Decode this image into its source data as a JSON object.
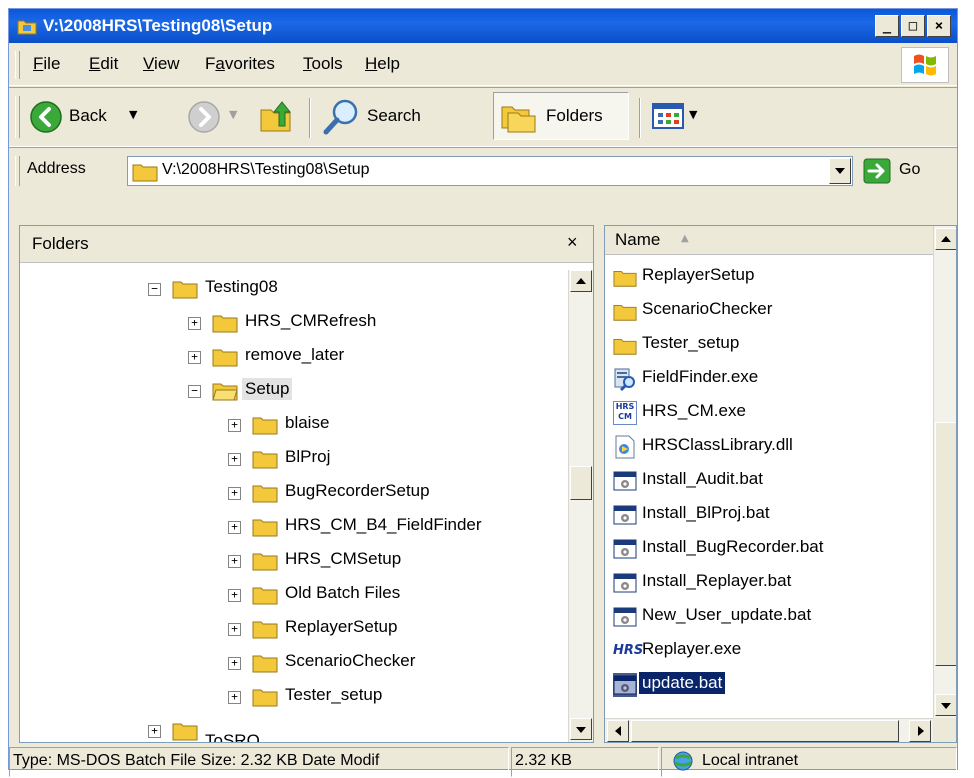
{
  "window": {
    "title": "V:\\2008HRS\\Testing08\\Setup",
    "controls": {
      "minimize": "_",
      "maximize": "□",
      "close": "×"
    }
  },
  "menu": [
    "File",
    "Edit",
    "View",
    "Favorites",
    "Tools",
    "Help"
  ],
  "menu_mnemonics": [
    "F",
    "E",
    "V",
    "a",
    "T",
    "H"
  ],
  "toolbar": {
    "back_label": "Back",
    "search_label": "Search",
    "folders_label": "Folders"
  },
  "address": {
    "label": "Address",
    "value": "V:\\2008HRS\\Testing08\\Setup",
    "go_label": "Go"
  },
  "folders_pane": {
    "title": "Folders",
    "close_glyph": "×",
    "tree": [
      {
        "label": "Testing08",
        "expander": "−"
      },
      {
        "label": "HRS_CMRefresh",
        "expander": "+"
      },
      {
        "label": "remove_later",
        "expander": "+"
      },
      {
        "label": "Setup",
        "expander": "−"
      },
      {
        "label": "blaise",
        "expander": "+"
      },
      {
        "label": "BlProj",
        "expander": "+"
      },
      {
        "label": "BugRecorderSetup",
        "expander": "+"
      },
      {
        "label": "HRS_CM_B4_FieldFinder",
        "expander": "+"
      },
      {
        "label": "HRS_CMSetup",
        "expander": "+"
      },
      {
        "label": "Old Batch Files",
        "expander": "+"
      },
      {
        "label": "ReplayerSetup",
        "expander": "+"
      },
      {
        "label": "ScenarioChecker",
        "expander": "+"
      },
      {
        "label": "Tester_setup",
        "expander": "+"
      },
      {
        "label": "ToSRO",
        "expander": "+"
      }
    ]
  },
  "files_pane": {
    "column_name": "Name",
    "sort_glyph": "▲",
    "files": [
      {
        "name": "ReplayerSetup",
        "icon": "folder-icon"
      },
      {
        "name": "ScenarioChecker",
        "icon": "folder-icon"
      },
      {
        "name": "Tester_setup",
        "icon": "folder-icon"
      },
      {
        "name": "FieldFinder.exe",
        "icon": "exe-icon"
      },
      {
        "name": "HRS_CM.exe",
        "icon": "hrs-cm-icon"
      },
      {
        "name": "HRSClassLibrary.dll",
        "icon": "dll-icon"
      },
      {
        "name": "Install_Audit.bat",
        "icon": "batch-file-icon"
      },
      {
        "name": "Install_BlProj.bat",
        "icon": "batch-file-icon"
      },
      {
        "name": "Install_BugRecorder.bat",
        "icon": "batch-file-icon"
      },
      {
        "name": "Install_Replayer.bat",
        "icon": "batch-file-icon"
      },
      {
        "name": "New_User_update.bat",
        "icon": "batch-file-icon"
      },
      {
        "name": "Replayer.exe",
        "icon": "hrs-icon"
      },
      {
        "name": "update.bat",
        "icon": "batch-file-icon"
      }
    ],
    "hrs_badge": "HRS",
    "hrs_cm_badge_top": "HRS",
    "hrs_cm_badge_bottom": "CM"
  },
  "status": {
    "info": "Type: MS-DOS Batch File Size: 2.32 KB Date Modif",
    "size": "2.32 KB",
    "zone": "Local intranet"
  },
  "colors": {
    "title_bar": "#0a58d8",
    "selection": "#0a246a",
    "folder": "#f3c83a",
    "chrome": "#ece9d8"
  }
}
